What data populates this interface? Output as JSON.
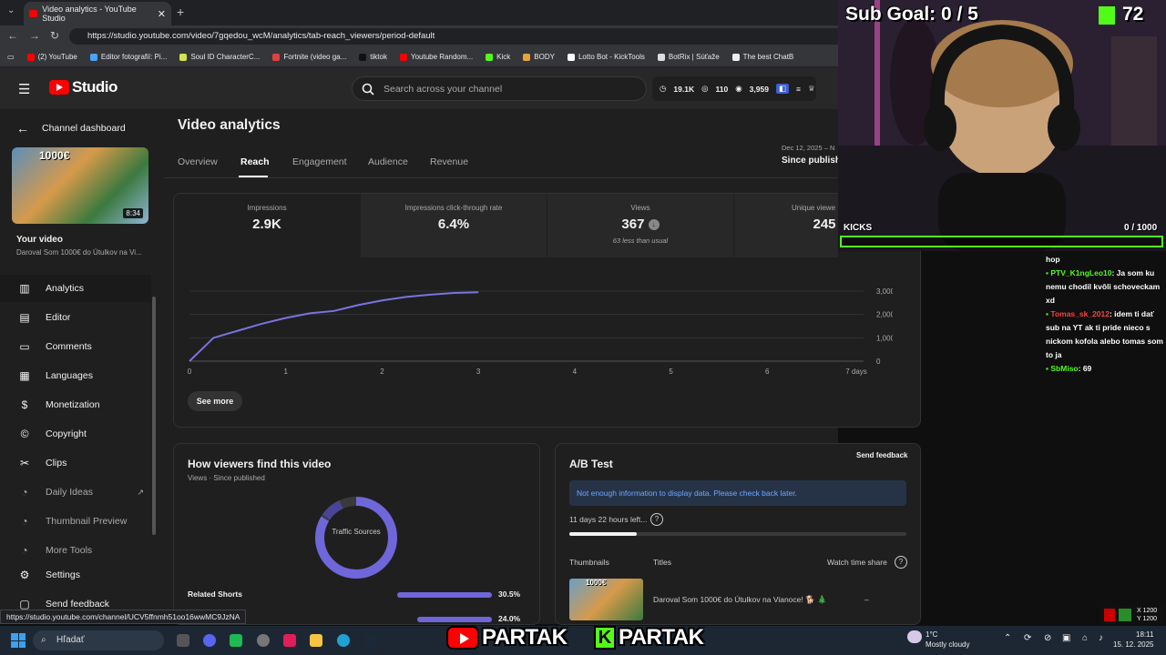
{
  "browser": {
    "tab_title": "Video analytics - YouTube Studio",
    "url": "https://studio.youtube.com/video/7gqedou_wcM/analytics/tab-reach_viewers/period-default",
    "bookmarks": [
      "(2) YouTube",
      "Editor fotografií: Pi...",
      "Soul ID CharacterC...",
      "Fortnite (video ga...",
      "tiktok",
      "Youtube Random...",
      "Kick",
      "BODY",
      "Lotto Bot - KickTools",
      "BotRix | Súťaže",
      "The best ChatB"
    ],
    "status_url": "https://studio.youtube.com/channel/UCV5ffnmh51oo16wwMC9JzNA"
  },
  "header": {
    "logo_text": "Studio",
    "search_placeholder": "Search across your channel",
    "stat_subs": "19.1K",
    "stat_videos": "110",
    "stat_views": "3,959"
  },
  "sidebar": {
    "back_label": "Channel dashboard",
    "thumb_money": "1000€",
    "thumb_duration": "8:34",
    "your_video": "Your video",
    "video_title": "Daroval Som 1000€ do Útulkov na Vi...",
    "items": [
      {
        "label": "Analytics",
        "icon": "analytics-icon"
      },
      {
        "label": "Editor",
        "icon": "editor-icon"
      },
      {
        "label": "Comments",
        "icon": "comments-icon"
      },
      {
        "label": "Languages",
        "icon": "languages-icon"
      },
      {
        "label": "Monetization",
        "icon": "monetization-icon"
      },
      {
        "label": "Copyright",
        "icon": "copyright-icon"
      },
      {
        "label": "Clips",
        "icon": "clips-icon"
      },
      {
        "label": "Daily Ideas",
        "icon": "daily-ideas-icon"
      },
      {
        "label": "Thumbnail Preview",
        "icon": "thumbnail-preview-icon"
      },
      {
        "label": "More Tools",
        "icon": "more-tools-icon"
      },
      {
        "label": "Settings",
        "icon": "settings-icon"
      },
      {
        "label": "Send feedback",
        "icon": "feedback-icon"
      }
    ]
  },
  "main": {
    "title": "Video analytics",
    "tabs": [
      "Overview",
      "Reach",
      "Engagement",
      "Audience",
      "Revenue"
    ],
    "selected_tab": "Reach",
    "date_range": "Dec 12, 2025 – N",
    "period": "Since publish",
    "metrics": [
      {
        "label": "Impressions",
        "value": "2.9K",
        "sub": ""
      },
      {
        "label": "Impressions click-through rate",
        "value": "6.4%",
        "sub": ""
      },
      {
        "label": "Views",
        "value": "367",
        "sub": "63 less than usual"
      },
      {
        "label": "Unique viewe",
        "value": "245",
        "sub": ""
      }
    ],
    "see_more": "See more",
    "how_viewers_title": "How viewers find this video",
    "how_viewers_sub": "Views · Since published",
    "donut_label": "Traffic Sources",
    "traffic_rows": [
      {
        "label": "Related Shorts",
        "value": "30.5%",
        "fraction": 0.305
      },
      {
        "label": "",
        "value": "24.0%",
        "fraction": 0.24
      }
    ],
    "ab_title": "A/B Test",
    "ab_feedback": "Send feedback",
    "ab_notice": "Not enough information to display data. Please check back later.",
    "ab_time_left": "11 days 22 hours left...",
    "ab_progress": 0.2,
    "ab_col_thumbnails": "Thumbnails",
    "ab_col_titles": "Titles",
    "ab_col_watch": "Watch time share",
    "ab_row_title": "Daroval Som 1000€ do Útulkov na Vianoce! 🐕 🎄",
    "ab_row_value": "–",
    "ab_row_thumb_text": "1000€"
  },
  "chart_data": {
    "type": "line",
    "x": [
      0,
      0.25,
      0.5,
      0.75,
      1,
      1.25,
      1.5,
      1.75,
      2,
      2.25,
      2.5,
      2.75,
      3
    ],
    "values": [
      0,
      1000,
      1300,
      1600,
      1850,
      2050,
      2150,
      2400,
      2600,
      2750,
      2850,
      2920,
      2950
    ],
    "xticks": [
      "0",
      "1",
      "2",
      "3",
      "4",
      "5",
      "6",
      "7 days"
    ],
    "yticks": [
      "0",
      "1,000",
      "2,000",
      "3,000"
    ],
    "ylim": [
      0,
      3000
    ],
    "xlim": [
      0,
      7
    ]
  },
  "overlay": {
    "sub_goal": "Sub Goal:  0 / 5",
    "kick_count": "72",
    "kicks_label": "KICKS",
    "kicks_progress": "0  / 1000",
    "chat": [
      {
        "user": "",
        "text": "hop"
      },
      {
        "user": "PTV_K1ngLeo10",
        "text": ": Ja som ku nemu chodil kvôli schoveckam xd"
      },
      {
        "user": "Tomas_sk_2012",
        "text": ": idem ti dať sub na YT ak ti pride nieco s nickom kofola alebo tomas som to ja"
      },
      {
        "user": "SbMiso",
        "text": ": 69"
      }
    ],
    "resolution_x": "X 1200",
    "resolution_y": "Y 1200",
    "brand_yt": "PARTAK",
    "brand_kick": "PARTAK"
  },
  "taskbar": {
    "search": "Hľadať",
    "weather_temp": "1°C",
    "weather_desc": "Mostly cloudy",
    "time": "18:11",
    "date": "15. 12. 2025"
  }
}
